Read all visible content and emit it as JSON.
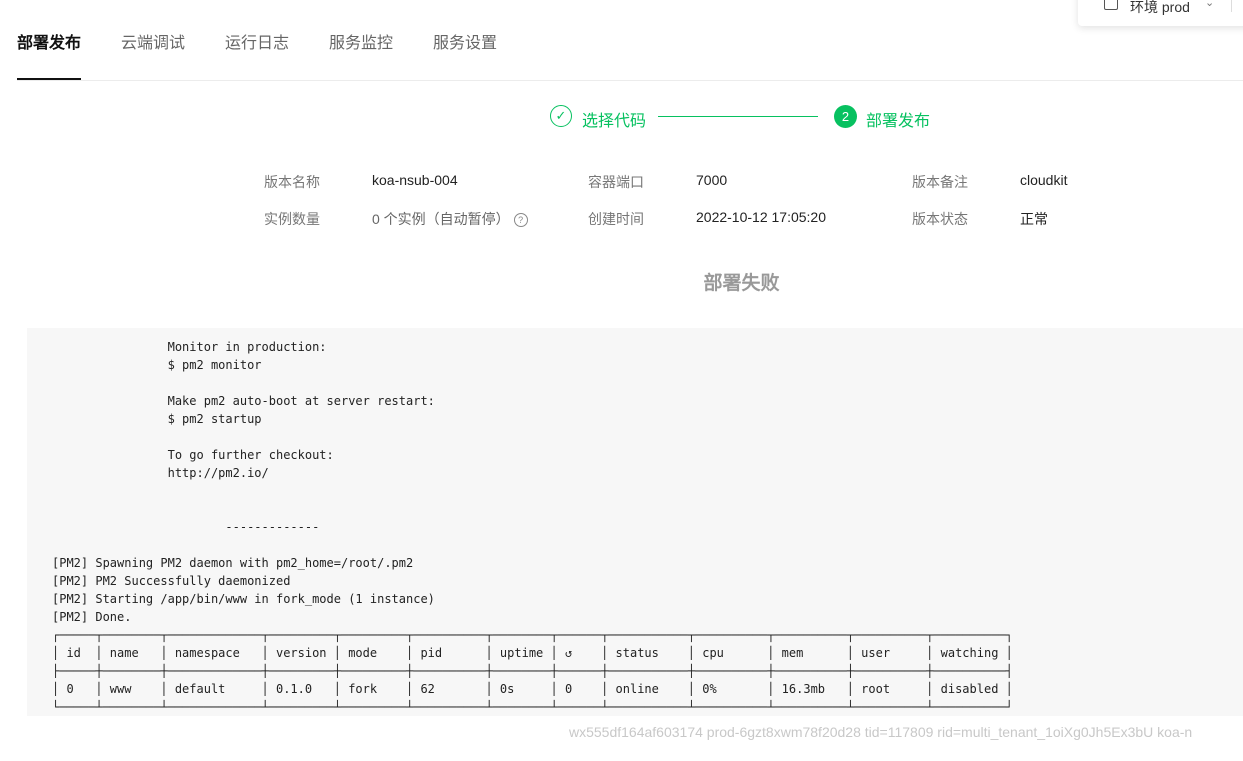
{
  "tabs": [
    {
      "label": "部署发布",
      "active": true
    },
    {
      "label": "云端调试",
      "active": false
    },
    {
      "label": "运行日志",
      "active": false
    },
    {
      "label": "服务监控",
      "active": false
    },
    {
      "label": "服务设置",
      "active": false
    }
  ],
  "env": {
    "label": "环境 prod",
    "icon": "env-icon"
  },
  "steps": [
    {
      "label": "选择代码",
      "icon": "check-icon",
      "status": "done"
    },
    {
      "label": "部署发布",
      "number": "2",
      "status": "current"
    }
  ],
  "accent_color": "#07c160",
  "info": {
    "version_name_label": "版本名称",
    "version_name": "koa-nsub-004",
    "port_label": "容器端口",
    "port": "7000",
    "remark_label": "版本备注",
    "remark": "cloudkit",
    "instances_label": "实例数量",
    "instances": "0 个实例（自动暂停）",
    "created_label": "创建时间",
    "created": "2022-10-12 17:05:20",
    "status_label": "版本状态",
    "status": "正常"
  },
  "deploy_status": "部署失败",
  "log": "                Monitor in production:\n                $ pm2 monitor\n\n                Make pm2 auto-boot at server restart:\n                $ pm2 startup\n\n                To go further checkout:\n                http://pm2.io/\n\n\n                        -------------\n\n[PM2] Spawning PM2 daemon with pm2_home=/root/.pm2\n[PM2] PM2 Successfully daemonized\n[PM2] Starting /app/bin/www in fork_mode (1 instance)\n[PM2] Done.\n┌─────┬────────┬─────────────┬─────────┬─────────┬──────────┬────────┬──────┬───────────┬──────────┬──────────┬──────────┬──────────┐\n│ id  │ name   │ namespace   │ version │ mode    │ pid      │ uptime │ ↺    │ status    │ cpu      │ mem      │ user     │ watching │\n├─────┼────────┼─────────────┼─────────┼─────────┼──────────┼────────┼──────┼───────────┼──────────┼──────────┼──────────┼──────────┤\n│ 0   │ www    │ default     │ 0.1.0   │ fork    │ 62       │ 0s     │ 0    │ online    │ 0%       │ 16.3mb   │ root     │ disabled │\n└─────┴────────┴─────────────┴─────────┴─────────┴──────────┴────────┴──────┴───────────┴──────────┴──────────┴──────────┴──────────┘",
  "footer": "wx555df164af603174 prod-6gzt8xwm78f20d28 tid=117809 rid=multi_tenant_1oiXg0Jh5Ex3bU koa-n"
}
